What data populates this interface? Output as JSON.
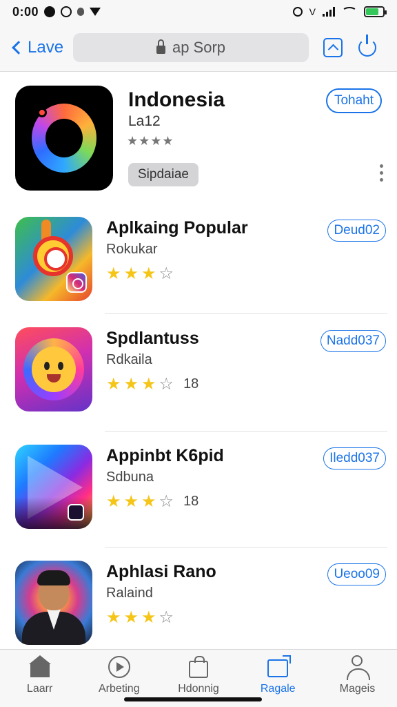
{
  "status_bar": {
    "time": "0:00",
    "net_label": "V",
    "battery_level": 0.75,
    "battery_color": "#34c759"
  },
  "nav": {
    "back_label": "Lave",
    "url": "ap Sorp"
  },
  "featured": {
    "title": "Indonesia",
    "subtitle": "La12",
    "stars_text": "★★★★",
    "tag": "Sipdaiae",
    "action_label": "Tohaht"
  },
  "apps": [
    {
      "title": "Aplkaing Popular",
      "subtitle": "Rokukar",
      "rating": 3,
      "count": "",
      "action_label": "Deud02"
    },
    {
      "title": "Spdlantuss",
      "subtitle": "Rdkaila",
      "rating": 3,
      "count": "18",
      "action_label": "Nadd037"
    },
    {
      "title": "Appinbt K6pid",
      "subtitle": "Sdbuna",
      "rating": 3,
      "count": "18",
      "action_label": "Iledd037"
    },
    {
      "title": "Aphlasi Rano",
      "subtitle": "Ralaind",
      "rating": 3,
      "count": "",
      "action_label": "Ueoo09"
    }
  ],
  "tabs": [
    {
      "label": "Laarr",
      "icon": "home-icon",
      "active": false
    },
    {
      "label": "Arbeting",
      "icon": "play-circle-icon",
      "active": false
    },
    {
      "label": "Hdonnig",
      "icon": "bag-icon",
      "active": false
    },
    {
      "label": "Ragale",
      "icon": "box-icon",
      "active": true
    },
    {
      "label": "Mageis",
      "icon": "person-icon",
      "active": false
    }
  ],
  "colors": {
    "accent": "#1a73e8",
    "star": "#f5c518"
  }
}
